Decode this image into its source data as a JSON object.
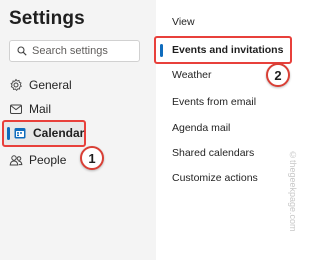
{
  "settings": {
    "title": "Settings",
    "search_placeholder": "Search settings"
  },
  "nav": {
    "items": [
      {
        "label": "General",
        "icon": "gear-icon"
      },
      {
        "label": "Mail",
        "icon": "mail-icon"
      },
      {
        "label": "Calendar",
        "icon": "calendar-icon",
        "selected": true
      },
      {
        "label": "People",
        "icon": "people-icon"
      }
    ]
  },
  "calendar_menu": {
    "items": [
      {
        "label": "View"
      },
      {
        "label": "Events and invitations",
        "selected": true
      },
      {
        "label": "Weather"
      },
      {
        "label": "Events from email"
      },
      {
        "label": "Agenda mail"
      },
      {
        "label": "Shared calendars"
      },
      {
        "label": "Customize actions"
      }
    ]
  },
  "annotations": {
    "badge_1": "1",
    "badge_2": "2",
    "highlight_color": "#e8403b"
  },
  "watermark": "©thegeekpage.com",
  "colors": {
    "accent": "#0f6cbd",
    "left_pane_bg": "#f4f4f4",
    "selected_bg": "#e8e8e8"
  }
}
